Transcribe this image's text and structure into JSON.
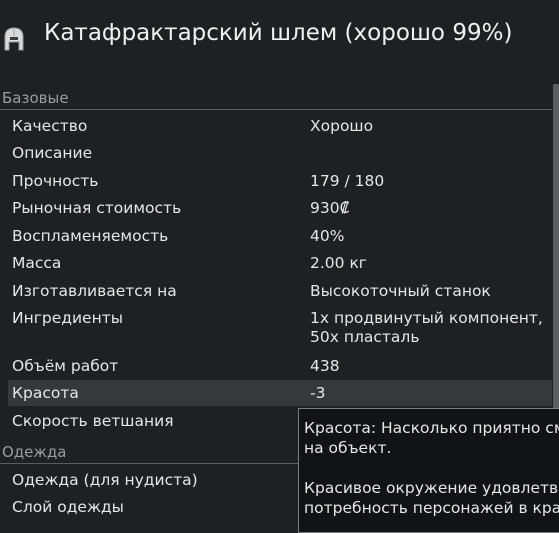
{
  "header": {
    "icon": "helmet-icon",
    "title": "Катафрактарский шлем (хорошо 99%)"
  },
  "sections": {
    "base": {
      "title": "Базовые",
      "rows": [
        {
          "label": "Качество",
          "value": "Хорошо"
        },
        {
          "label": "Описание",
          "value": ""
        },
        {
          "label": "Прочность",
          "value": "179 / 180"
        },
        {
          "label": "Рыночная стоимость",
          "value": "930₡"
        },
        {
          "label": "Воспламеняемость",
          "value": "40%"
        },
        {
          "label": "Масса",
          "value": "2.00 кг"
        },
        {
          "label": "Изготавливается на",
          "value": "Высокоточный станок"
        },
        {
          "label": "Ингредиенты",
          "value": "1x продвинутый компонент,\n50x пласталь"
        },
        {
          "label": "Объём работ",
          "value": "438"
        },
        {
          "label": "Красота",
          "value": "-3"
        },
        {
          "label": "Скорость ветшания",
          "value": ""
        }
      ]
    },
    "apparel": {
      "title": "Одежда",
      "rows": [
        {
          "label": "Одежда (для нудиста)",
          "value": ""
        },
        {
          "label": "Слой одежды",
          "value": ""
        }
      ]
    }
  },
  "tooltip": {
    "line1": "Красота: Насколько приятно см\nна объект.",
    "line2": "Красивое окружение удовлетво\nпотребность персонажей в кра"
  },
  "colors": {
    "background": "#1e2022",
    "row_highlight": "#36383b",
    "tooltip_bg": "#111314",
    "tooltip_border": "#7a7d80"
  }
}
